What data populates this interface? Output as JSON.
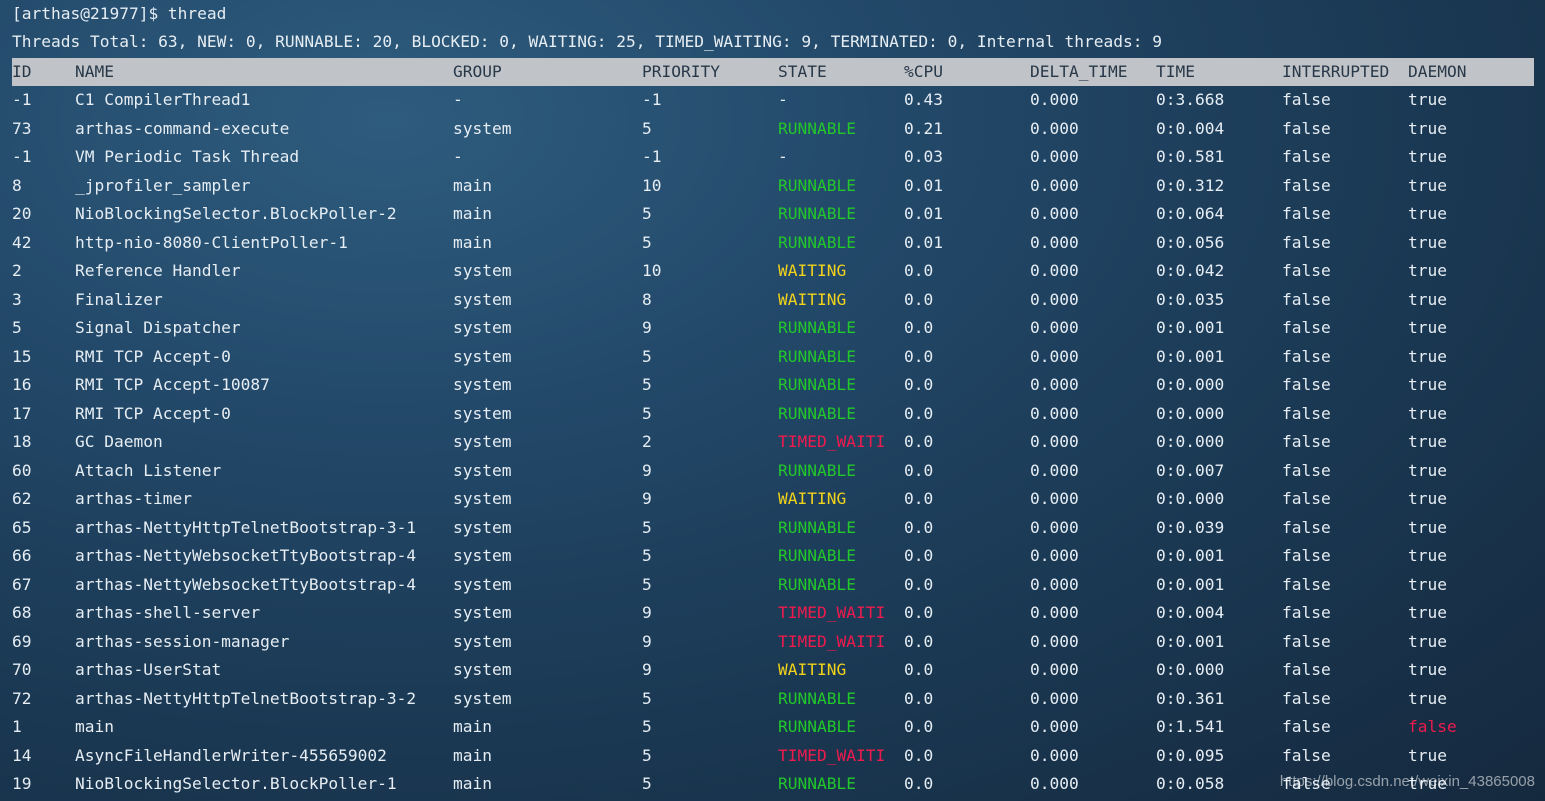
{
  "terminal": {
    "prompt": "[arthas@21977]$ thread",
    "summary": "Threads Total: 63, NEW: 0, RUNNABLE: 20, BLOCKED: 0, WAITING: 25, TIMED_WAITING: 9, TERMINATED: 0, Internal threads: 9"
  },
  "colors": {
    "runnable": "#22c82a",
    "waiting": "#f2d21a",
    "timed_waiting": "#ee1a4e",
    "header_bg": "#c0c4c8"
  },
  "table": {
    "headers": {
      "id": "ID",
      "name": "NAME",
      "group": "GROUP",
      "priority": "PRIORITY",
      "state": "STATE",
      "cpu": "%CPU",
      "delta_time": "DELTA_TIME",
      "time": "TIME",
      "interrupted": "INTERRUPTED",
      "daemon": "DAEMON"
    },
    "rows": [
      {
        "id": "-1",
        "name": "C1 CompilerThread1",
        "group": "-",
        "priority": "-1",
        "state": "-",
        "cpu": "0.43",
        "delta_time": "0.000",
        "time": "0:3.668",
        "interrupted": "false",
        "daemon": "true"
      },
      {
        "id": "73",
        "name": "arthas-command-execute",
        "group": "system",
        "priority": "5",
        "state": "RUNNABLE",
        "cpu": "0.21",
        "delta_time": "0.000",
        "time": "0:0.004",
        "interrupted": "false",
        "daemon": "true"
      },
      {
        "id": "-1",
        "name": "VM Periodic Task Thread",
        "group": "-",
        "priority": "-1",
        "state": "-",
        "cpu": "0.03",
        "delta_time": "0.000",
        "time": "0:0.581",
        "interrupted": "false",
        "daemon": "true"
      },
      {
        "id": "8",
        "name": "_jprofiler_sampler",
        "group": "main",
        "priority": "10",
        "state": "RUNNABLE",
        "cpu": "0.01",
        "delta_time": "0.000",
        "time": "0:0.312",
        "interrupted": "false",
        "daemon": "true"
      },
      {
        "id": "20",
        "name": "NioBlockingSelector.BlockPoller-2",
        "group": "main",
        "priority": "5",
        "state": "RUNNABLE",
        "cpu": "0.01",
        "delta_time": "0.000",
        "time": "0:0.064",
        "interrupted": "false",
        "daemon": "true"
      },
      {
        "id": "42",
        "name": "http-nio-8080-ClientPoller-1",
        "group": "main",
        "priority": "5",
        "state": "RUNNABLE",
        "cpu": "0.01",
        "delta_time": "0.000",
        "time": "0:0.056",
        "interrupted": "false",
        "daemon": "true"
      },
      {
        "id": "2",
        "name": "Reference Handler",
        "group": "system",
        "priority": "10",
        "state": "WAITING",
        "cpu": "0.0",
        "delta_time": "0.000",
        "time": "0:0.042",
        "interrupted": "false",
        "daemon": "true"
      },
      {
        "id": "3",
        "name": "Finalizer",
        "group": "system",
        "priority": "8",
        "state": "WAITING",
        "cpu": "0.0",
        "delta_time": "0.000",
        "time": "0:0.035",
        "interrupted": "false",
        "daemon": "true"
      },
      {
        "id": "5",
        "name": "Signal Dispatcher",
        "group": "system",
        "priority": "9",
        "state": "RUNNABLE",
        "cpu": "0.0",
        "delta_time": "0.000",
        "time": "0:0.001",
        "interrupted": "false",
        "daemon": "true"
      },
      {
        "id": "15",
        "name": "RMI TCP Accept-0",
        "group": "system",
        "priority": "5",
        "state": "RUNNABLE",
        "cpu": "0.0",
        "delta_time": "0.000",
        "time": "0:0.001",
        "interrupted": "false",
        "daemon": "true"
      },
      {
        "id": "16",
        "name": "RMI TCP Accept-10087",
        "group": "system",
        "priority": "5",
        "state": "RUNNABLE",
        "cpu": "0.0",
        "delta_time": "0.000",
        "time": "0:0.000",
        "interrupted": "false",
        "daemon": "true"
      },
      {
        "id": "17",
        "name": "RMI TCP Accept-0",
        "group": "system",
        "priority": "5",
        "state": "RUNNABLE",
        "cpu": "0.0",
        "delta_time": "0.000",
        "time": "0:0.000",
        "interrupted": "false",
        "daemon": "true"
      },
      {
        "id": "18",
        "name": "GC Daemon",
        "group": "system",
        "priority": "2",
        "state": "TIMED_WAITI",
        "cpu": "0.0",
        "delta_time": "0.000",
        "time": "0:0.000",
        "interrupted": "false",
        "daemon": "true"
      },
      {
        "id": "60",
        "name": "Attach Listener",
        "group": "system",
        "priority": "9",
        "state": "RUNNABLE",
        "cpu": "0.0",
        "delta_time": "0.000",
        "time": "0:0.007",
        "interrupted": "false",
        "daemon": "true"
      },
      {
        "id": "62",
        "name": "arthas-timer",
        "group": "system",
        "priority": "9",
        "state": "WAITING",
        "cpu": "0.0",
        "delta_time": "0.000",
        "time": "0:0.000",
        "interrupted": "false",
        "daemon": "true"
      },
      {
        "id": "65",
        "name": "arthas-NettyHttpTelnetBootstrap-3-1",
        "group": "system",
        "priority": "5",
        "state": "RUNNABLE",
        "cpu": "0.0",
        "delta_time": "0.000",
        "time": "0:0.039",
        "interrupted": "false",
        "daemon": "true"
      },
      {
        "id": "66",
        "name": "arthas-NettyWebsocketTtyBootstrap-4",
        "group": "system",
        "priority": "5",
        "state": "RUNNABLE",
        "cpu": "0.0",
        "delta_time": "0.000",
        "time": "0:0.001",
        "interrupted": "false",
        "daemon": "true"
      },
      {
        "id": "67",
        "name": "arthas-NettyWebsocketTtyBootstrap-4",
        "group": "system",
        "priority": "5",
        "state": "RUNNABLE",
        "cpu": "0.0",
        "delta_time": "0.000",
        "time": "0:0.001",
        "interrupted": "false",
        "daemon": "true"
      },
      {
        "id": "68",
        "name": "arthas-shell-server",
        "group": "system",
        "priority": "9",
        "state": "TIMED_WAITI",
        "cpu": "0.0",
        "delta_time": "0.000",
        "time": "0:0.004",
        "interrupted": "false",
        "daemon": "true"
      },
      {
        "id": "69",
        "name": "arthas-session-manager",
        "group": "system",
        "priority": "9",
        "state": "TIMED_WAITI",
        "cpu": "0.0",
        "delta_time": "0.000",
        "time": "0:0.001",
        "interrupted": "false",
        "daemon": "true"
      },
      {
        "id": "70",
        "name": "arthas-UserStat",
        "group": "system",
        "priority": "9",
        "state": "WAITING",
        "cpu": "0.0",
        "delta_time": "0.000",
        "time": "0:0.000",
        "interrupted": "false",
        "daemon": "true"
      },
      {
        "id": "72",
        "name": "arthas-NettyHttpTelnetBootstrap-3-2",
        "group": "system",
        "priority": "5",
        "state": "RUNNABLE",
        "cpu": "0.0",
        "delta_time": "0.000",
        "time": "0:0.361",
        "interrupted": "false",
        "daemon": "true"
      },
      {
        "id": "1",
        "name": "main",
        "group": "main",
        "priority": "5",
        "state": "RUNNABLE",
        "cpu": "0.0",
        "delta_time": "0.000",
        "time": "0:1.541",
        "interrupted": "false",
        "daemon": "false"
      },
      {
        "id": "14",
        "name": "AsyncFileHandlerWriter-455659002",
        "group": "main",
        "priority": "5",
        "state": "TIMED_WAITI",
        "cpu": "0.0",
        "delta_time": "0.000",
        "time": "0:0.095",
        "interrupted": "false",
        "daemon": "true"
      },
      {
        "id": "19",
        "name": "NioBlockingSelector.BlockPoller-1",
        "group": "main",
        "priority": "5",
        "state": "RUNNABLE",
        "cpu": "0.0",
        "delta_time": "0.000",
        "time": "0:0.058",
        "interrupted": "false",
        "daemon": "true"
      }
    ]
  },
  "watermark": "https://blog.csdn.net/weixin_43865008"
}
